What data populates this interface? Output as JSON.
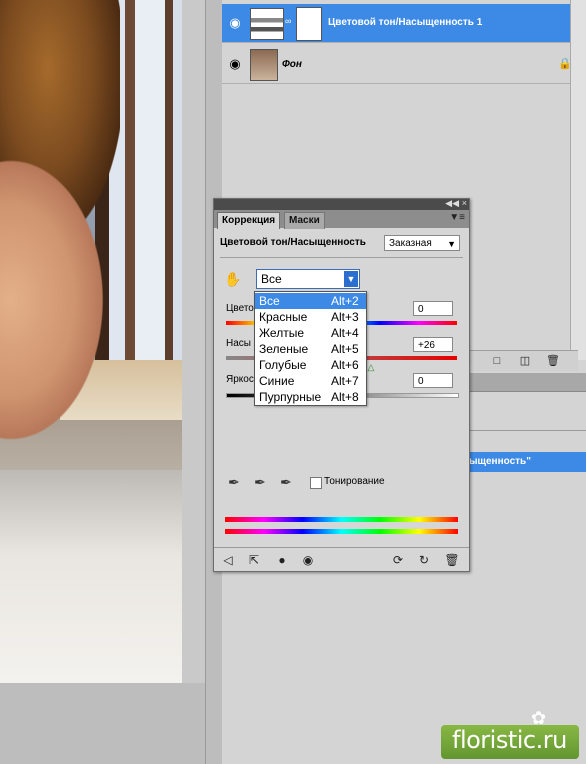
{
  "layers": [
    {
      "name": "Цветовой тон/Насыщенность 1",
      "selected": true
    },
    {
      "name": "Фон",
      "locked": true
    }
  ],
  "history": {
    "selected_item": "ыщенность\""
  },
  "panel": {
    "tabs": [
      "Коррекция",
      "Маски"
    ],
    "active_tab": "Коррекция",
    "title": "Цветовой тон/Насыщенность",
    "preset": "Заказная",
    "channel": "Все",
    "rows": [
      {
        "label": "Цвето",
        "value": "0"
      },
      {
        "label": "Насы",
        "value": "+26"
      },
      {
        "label": "Яркос",
        "value": "0"
      }
    ],
    "colorize_label": "Тонирование",
    "colorize_checked": false
  },
  "dropdown": {
    "items": [
      {
        "label": "Все",
        "shortcut": "Alt+2",
        "selected": true
      },
      {
        "label": "Красные",
        "shortcut": "Alt+3"
      },
      {
        "label": "Желтые",
        "shortcut": "Alt+4"
      },
      {
        "label": "Зеленые",
        "shortcut": "Alt+5"
      },
      {
        "label": "Голубые",
        "shortcut": "Alt+6"
      },
      {
        "label": "Синие",
        "shortcut": "Alt+7"
      },
      {
        "label": "Пурпурные",
        "shortcut": "Alt+8"
      }
    ]
  },
  "saturation_level": 0.63,
  "watermark": "floristic.ru",
  "colors": {
    "selection": "#3d8ae6",
    "panel": "#d6d6d6",
    "dock": "#d4d4d4"
  },
  "icons": [
    "eye-icon",
    "lock-icon",
    "hand-icon",
    "eyedropper-icon",
    "eyedropper-plus-icon",
    "eyedropper-minus-icon",
    "back-arrow-icon",
    "expand-icon",
    "mask-icon",
    "visibility-icon",
    "reset-icon",
    "trash-icon"
  ]
}
